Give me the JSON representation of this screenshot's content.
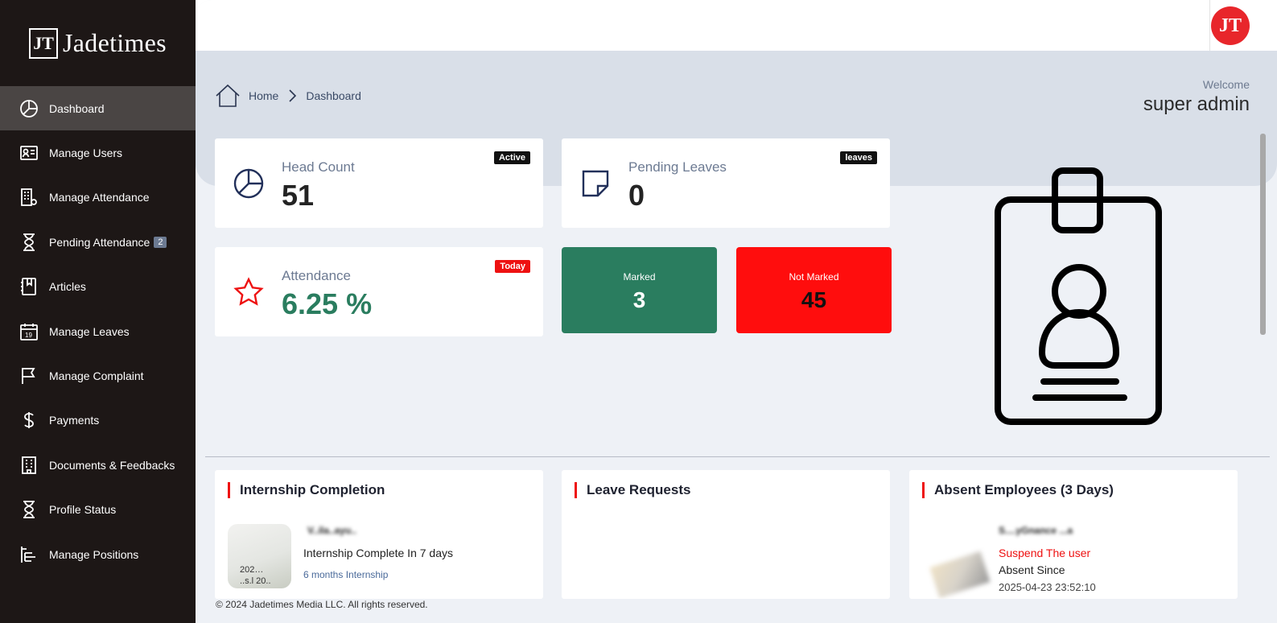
{
  "brand": {
    "logo_mark": "JT",
    "name": "Jadetimes"
  },
  "sidebar": {
    "items": [
      {
        "label": "Dashboard",
        "icon": "pie-chart-icon",
        "active": true
      },
      {
        "label": "Manage Users",
        "icon": "id-card-icon"
      },
      {
        "label": "Manage Attendance",
        "icon": "building-gear-icon"
      },
      {
        "label": "Pending Attendance",
        "icon": "hourglass-icon",
        "badge": "2"
      },
      {
        "label": "Articles",
        "icon": "journal-bookmark-icon"
      },
      {
        "label": "Manage Leaves",
        "icon": "calendar-icon"
      },
      {
        "label": "Manage Complaint",
        "icon": "flag-icon"
      },
      {
        "label": "Payments",
        "icon": "dollar-icon"
      },
      {
        "label": "Documents & Feedbacks",
        "icon": "building-icon"
      },
      {
        "label": "Profile Status",
        "icon": "hourglass-icon"
      },
      {
        "label": "Manage Positions",
        "icon": "list-tree-icon"
      }
    ]
  },
  "topbar": {
    "avatar_mark": "JT"
  },
  "breadcrumb": {
    "home": "Home",
    "current": "Dashboard"
  },
  "welcome": {
    "label": "Welcome",
    "name": "super admin"
  },
  "stats": {
    "head_count": {
      "label": "Head Count",
      "value": "51",
      "tag": "Active"
    },
    "pending_leaves": {
      "label": "Pending Leaves",
      "value": "0",
      "tag": "leaves"
    },
    "attendance": {
      "label": "Attendance",
      "value": "6.25 %",
      "tag": "Today"
    },
    "marked": {
      "label": "Marked",
      "value": "3"
    },
    "not_marked": {
      "label": "Not Marked",
      "value": "45"
    }
  },
  "panels": {
    "internship": {
      "title": "Internship Completion",
      "name": "V..ila..ayu..",
      "thumb_text": "202…\n..s.l 20..",
      "completion": "Internship Complete In 7 days",
      "duration": "6 months Internship"
    },
    "leave_requests": {
      "title": "Leave Requests"
    },
    "absent": {
      "title": "Absent Employees (3 Days)",
      "name": "S....yGnance ...a",
      "suspend": "Suspend The user",
      "absent_since": "Absent Since",
      "date": "2025-04-23 23:52:10"
    }
  },
  "footer": {
    "copyright": "© 2024 Jadetimes Media LLC. All rights reserved."
  },
  "colors": {
    "sidebar_bg": "#1d1716",
    "accent_red": "#e8262b",
    "marked_green": "#2a7d5f",
    "not_marked_red": "#ff0d0d"
  }
}
